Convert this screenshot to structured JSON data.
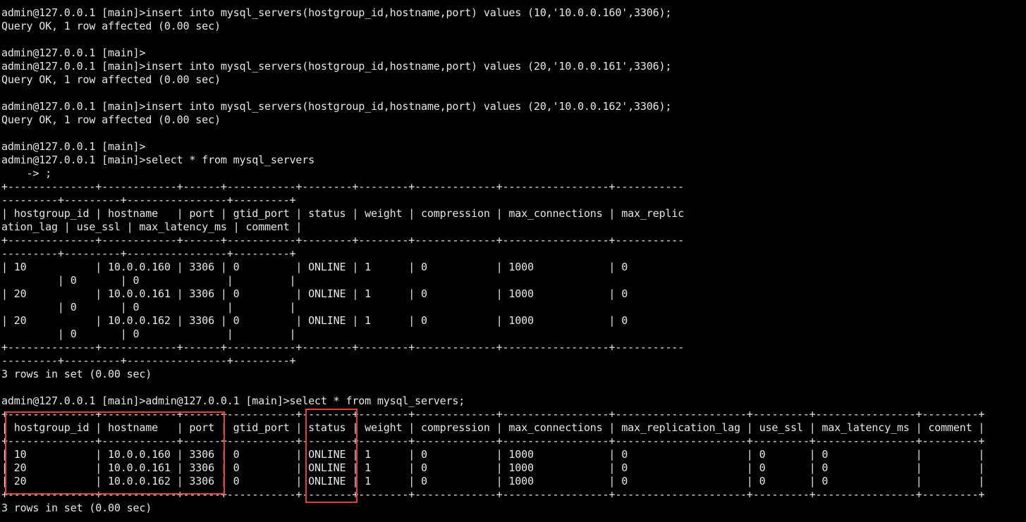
{
  "terminal": {
    "lines": [
      "admin@127.0.0.1 [main]>insert into mysql_servers(hostgroup_id,hostname,port) values (10,'10.0.0.160',3306);",
      "Query OK, 1 row affected (0.00 sec)",
      "",
      "admin@127.0.0.1 [main]>",
      "admin@127.0.0.1 [main]>insert into mysql_servers(hostgroup_id,hostname,port) values (20,'10.0.0.161',3306);",
      "Query OK, 1 row affected (0.00 sec)",
      "",
      "admin@127.0.0.1 [main]>insert into mysql_servers(hostgroup_id,hostname,port) values (20,'10.0.0.162',3306);",
      "Query OK, 1 row affected (0.00 sec)",
      "",
      "admin@127.0.0.1 [main]>",
      "admin@127.0.0.1 [main]>select * from mysql_servers",
      "    -> ;",
      "+--------------+------------+------+-----------+--------+--------+-------------+-----------------+-----------",
      "---------+---------+----------------+---------+",
      "| hostgroup_id | hostname   | port | gtid_port | status | weight | compression | max_connections | max_replic",
      "ation_lag | use_ssl | max_latency_ms | comment |",
      "+--------------+------------+------+-----------+--------+--------+-------------+-----------------+-----------",
      "---------+---------+----------------+---------+",
      "| 10           | 10.0.0.160 | 3306 | 0         | ONLINE | 1      | 0           | 1000            | 0",
      "         | 0       | 0              |         |",
      "| 20           | 10.0.0.161 | 3306 | 0         | ONLINE | 1      | 0           | 1000            | 0",
      "         | 0       | 0              |         |",
      "| 20           | 10.0.0.162 | 3306 | 0         | ONLINE | 1      | 0           | 1000            | 0",
      "         | 0       | 0              |         |",
      "+--------------+------------+------+-----------+--------+--------+-------------+-----------------+-----------",
      "---------+---------+----------------+---------+",
      "3 rows in set (0.00 sec)",
      "",
      "admin@127.0.0.1 [main]>admin@127.0.0.1 [main]>select * from mysql_servers;",
      "+--------------+------------+------+-----------+--------+--------+-------------+-----------------+---------------------+---------+----------------+---------+",
      "| hostgroup_id | hostname   | port | gtid_port | status | weight | compression | max_connections | max_replication_lag | use_ssl | max_latency_ms | comment |",
      "+--------------+------------+------+-----------+--------+--------+-------------+-----------------+---------------------+---------+----------------+---------+",
      "| 10           | 10.0.0.160 | 3306 | 0         | ONLINE | 1      | 0           | 1000            | 0                   | 0       | 0              |         |",
      "| 20           | 10.0.0.161 | 3306 | 0         | ONLINE | 1      | 0           | 1000            | 0                   | 0       | 0              |         |",
      "| 20           | 10.0.0.162 | 3306 | 0         | ONLINE | 1      | 0           | 1000            | 0                   | 0       | 0              |         |",
      "+--------------+------------+------+-----------+--------+--------+-------------+-----------------+---------------------+---------+----------------+---------+",
      "3 rows in set (0.00 sec)"
    ]
  },
  "colors": {
    "background": "#000000",
    "foreground": "#e6e6e6",
    "highlight_border": "#e0403f"
  }
}
